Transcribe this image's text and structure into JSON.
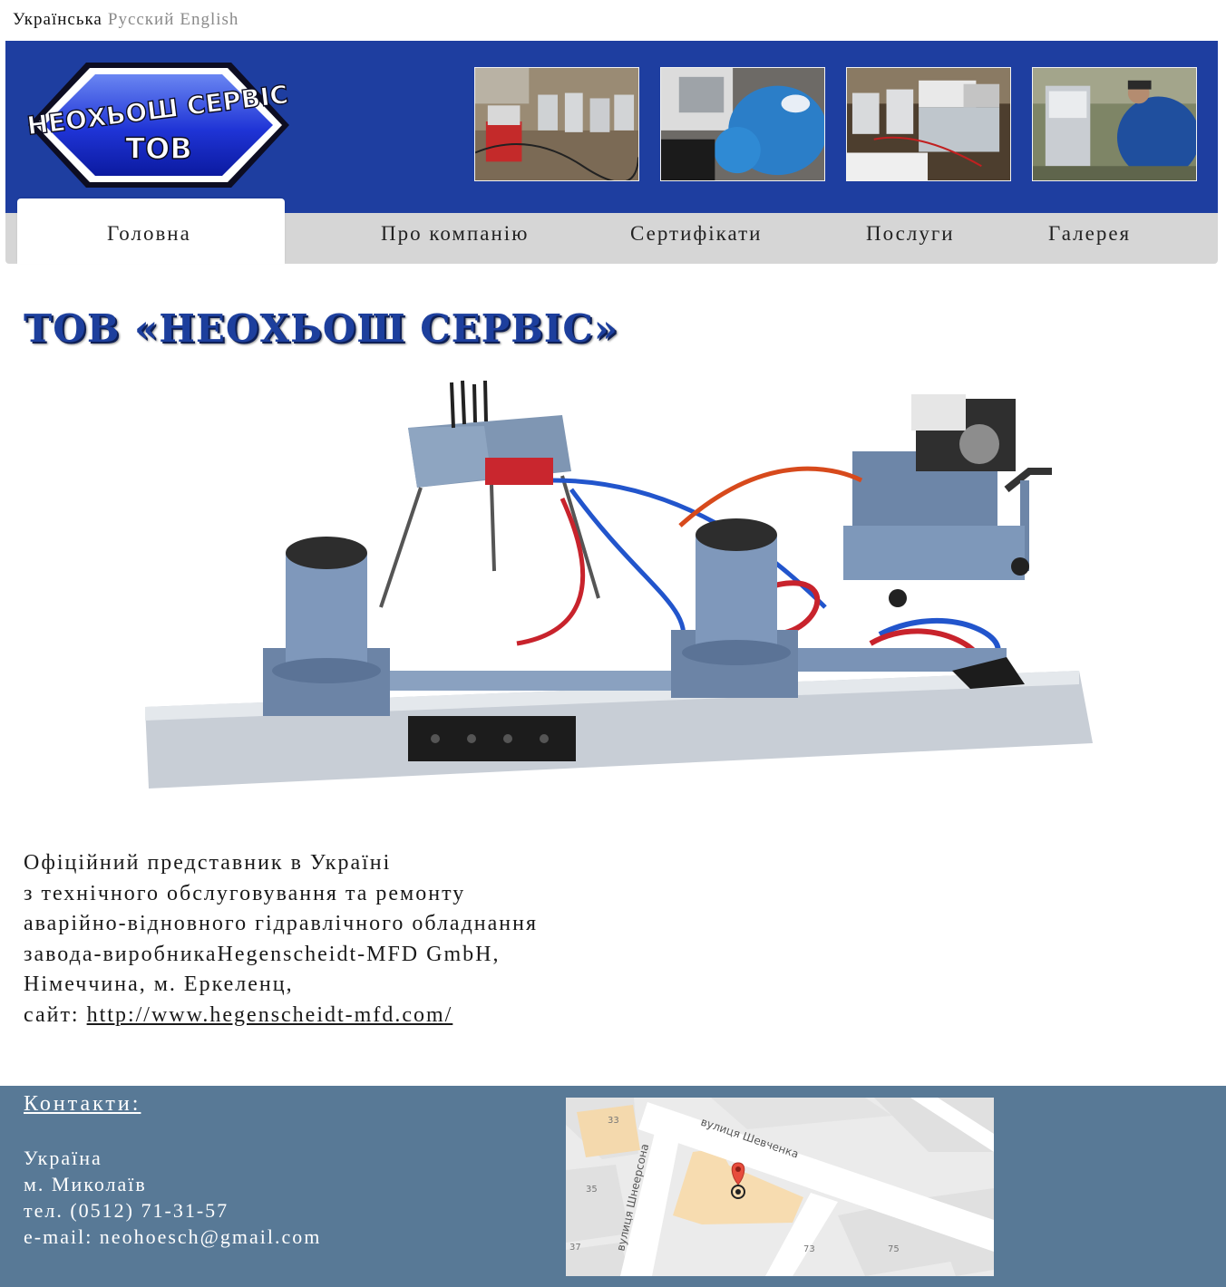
{
  "languages": {
    "active": "Українська",
    "options": [
      "Русский",
      "English"
    ]
  },
  "logo": {
    "line1": "НЕОХЬОШ СЕРВІС",
    "line2": "ТОВ"
  },
  "nav": {
    "items": [
      "Головна",
      "Про компанію",
      "Сертифікати",
      "Послуги",
      "Галерея"
    ],
    "active": "Головна"
  },
  "page_title": "ТОВ «НЕОХЬОШ СЕРВІС»",
  "intro": {
    "lines": [
      "Офіційний представник в Україні",
      "з технічного обслуговування та ремонту",
      "аварійно-відновного гідравлічного обладнання",
      "завода-виробникаHegenscheidt-MFD GmbH,",
      "Німеччина, м. Еркеленц,"
    ],
    "site_label": "сайт: ",
    "site_link": "http://www.hegenscheidt-mfd.com/"
  },
  "contacts": {
    "title": "Контакти:",
    "country": "Україна",
    "city": "м. Миколаїв",
    "phone": "тел. (0512) 71-31-57",
    "email": "e-mail: neohoesch@gmail.com"
  },
  "map": {
    "street1": "вулиця Шевченка",
    "street2": "вулиця Шнеерсона",
    "numbers": [
      "33",
      "35",
      "37",
      "73",
      "75"
    ]
  },
  "colors": {
    "header_bg": "#1e3ea0",
    "nav_bg": "#d6d6d6",
    "footer_bg": "#587996",
    "title_blue": "#1d3f9d"
  }
}
